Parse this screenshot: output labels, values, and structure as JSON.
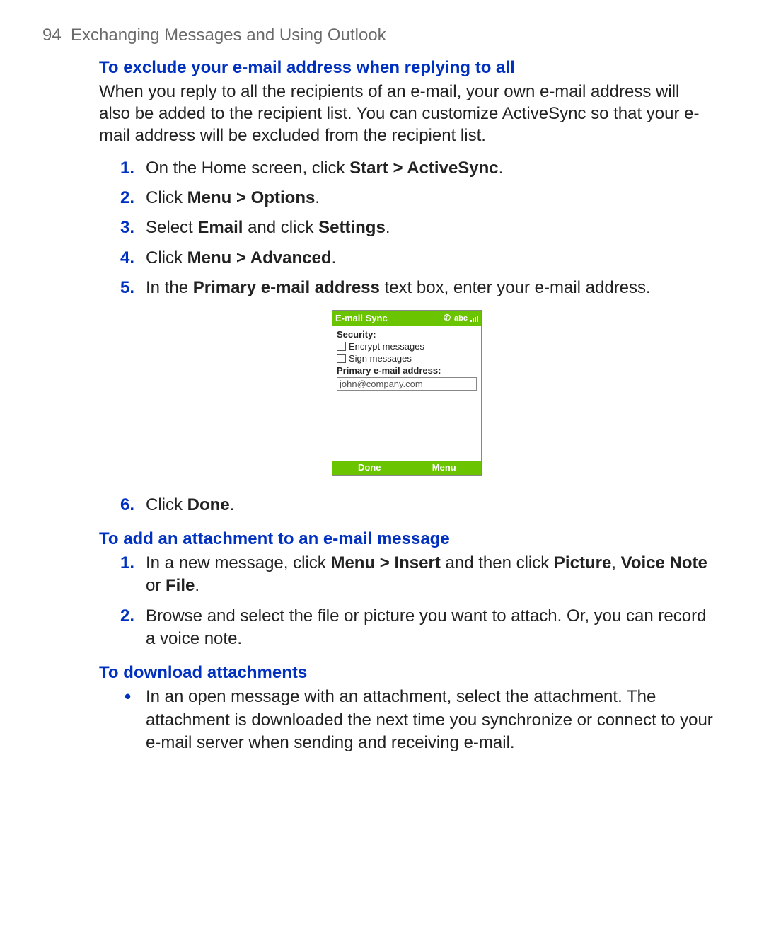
{
  "page": {
    "number": "94",
    "header": "Exchanging Messages and Using Outlook"
  },
  "sections": [
    {
      "title": "To exclude your e-mail address when replying to all",
      "intro_parts": [
        "When you reply to all the recipients of an e-mail, your own e-mail address will also be added to the recipient list. You can customize ActiveSync so that your e-mail address will be excluded from the recipient list."
      ],
      "steps_a": [
        {
          "num": "1.",
          "pre": "On the Home screen, click ",
          "bold": "Start > ActiveSync",
          "post": "."
        },
        {
          "num": "2.",
          "pre": "Click ",
          "bold": "Menu > Options",
          "post": "."
        },
        {
          "num": "3.",
          "pre": "Select ",
          "bold": "Email",
          "mid": " and click ",
          "bold2": "Settings",
          "post": "."
        },
        {
          "num": "4.",
          "pre": "Click ",
          "bold": "Menu > Advanced",
          "post": "."
        },
        {
          "num": "5.",
          "pre": "In the ",
          "bold": "Primary e-mail address",
          "post": " text box, enter your e-mail address."
        }
      ],
      "steps_b": [
        {
          "num": "6.",
          "pre": "Click ",
          "bold": "Done",
          "post": "."
        }
      ]
    },
    {
      "title": "To add an attachment to an e-mail message",
      "steps_a": [
        {
          "num": "1.",
          "pre": "In a new message, click ",
          "bold": "Menu > Insert",
          "mid": " and then click ",
          "bold2": "Picture",
          "sep": ", ",
          "bold3": "Voice Note",
          "sep2": " or ",
          "bold4": "File",
          "post": "."
        },
        {
          "num": "2.",
          "pre": "Browse and select the file or picture you want to attach. Or, you can record a voice note."
        }
      ]
    },
    {
      "title": "To download attachments",
      "bullets": [
        "In an open message with an attachment, select the attachment. The attachment is downloaded the next time you synchronize or connect to your e-mail server when sending and receiving e-mail."
      ]
    }
  ],
  "phone": {
    "title": "E-mail Sync",
    "status_abc": "abc",
    "security_label": "Security:",
    "encrypt_label": "Encrypt messages",
    "sign_label": "Sign messages",
    "primary_label": "Primary e-mail address:",
    "email_value": "john@company.com",
    "softkey_left": "Done",
    "softkey_right": "Menu"
  }
}
